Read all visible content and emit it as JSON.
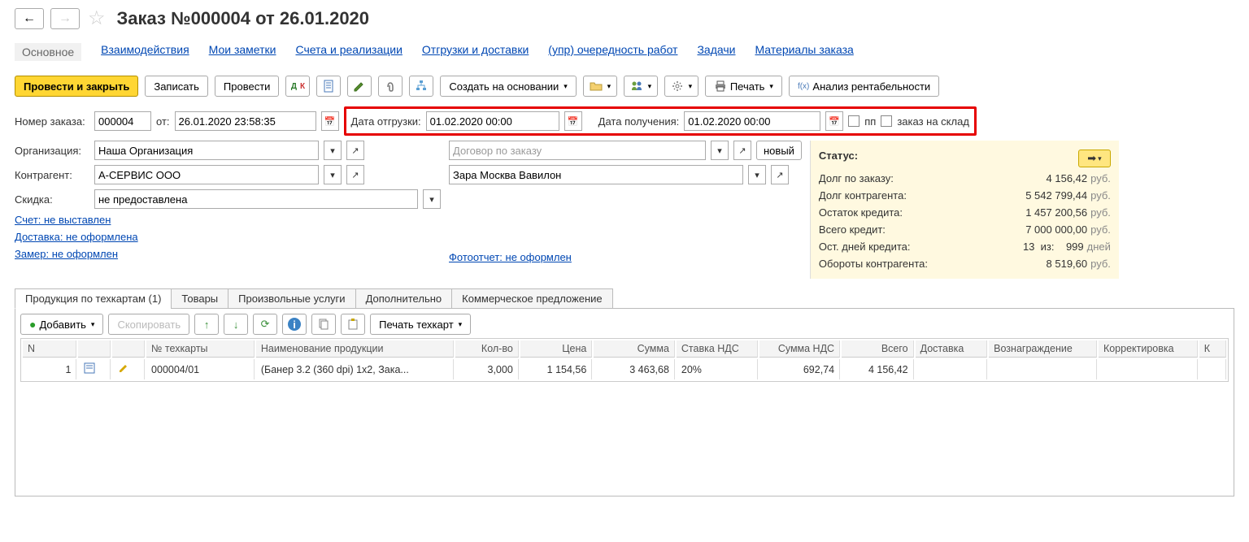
{
  "title": "Заказ №000004 от 26.01.2020",
  "nav_tabs": [
    "Основное",
    "Взаимодействия",
    "Мои заметки",
    "Счета и реализации",
    "Отгрузки и доставки",
    "(упр) очередность работ",
    "Задачи",
    "Материалы заказа"
  ],
  "toolbar": {
    "process_close": "Провести и закрыть",
    "record": "Записать",
    "process": "Провести",
    "create_based": "Создать на основании",
    "print": "Печать",
    "profit": "Анализ рентабельности"
  },
  "form": {
    "order_no_lbl": "Номер заказа:",
    "order_no": "000004",
    "from_lbl": "от:",
    "order_dt": "26.01.2020 23:58:35",
    "ship_lbl": "Дата отгрузки:",
    "ship_dt": "01.02.2020 00:00",
    "recv_lbl": "Дата получения:",
    "recv_dt": "01.02.2020 00:00",
    "pp_lbl": "пп",
    "to_stock_lbl": "заказ на склад",
    "org_lbl": "Организация:",
    "org": "Наша Организация",
    "contract_ph": "Договор по заказу",
    "new_btn": "новый",
    "contr_lbl": "Контрагент:",
    "contr": "А-СЕРВИС ООО",
    "addr": "Зара Москва Вавилон",
    "disc_lbl": "Скидка:",
    "disc": "не предоставлена",
    "invoice_link": "Счет: не выставлен",
    "delivery_link": "Доставка: не оформлена",
    "measure_link": "Замер: не оформлен",
    "photo_link": "Фотоотчет: не оформлен"
  },
  "status": {
    "title": "Статус:",
    "rows": [
      {
        "l": "Долг по заказу:",
        "v": "4 156,42",
        "u": "руб."
      },
      {
        "l": "Долг контрагента:",
        "v": "5 542 799,44",
        "u": "руб."
      },
      {
        "l": "Остаток кредита:",
        "v": "1 457 200,56",
        "u": "руб."
      },
      {
        "l": "Всего кредит:",
        "v": "7 000 000,00",
        "u": "руб."
      }
    ],
    "credit_days_lbl": "Ост. дней кредита:",
    "credit_days": "13",
    "of_lbl": "из:",
    "of_val": "999",
    "days_u": "дней",
    "turnover_lbl": "Обороты контрагента:",
    "turnover": "8 519,60",
    "turnover_u": "руб."
  },
  "subtabs": [
    "Продукция по техкартам (1)",
    "Товары",
    "Произвольные услуги",
    "Дополнительно",
    "Коммерческое предложение"
  ],
  "grid_toolbar": {
    "add": "Добавить",
    "copy": "Скопировать",
    "print_tc": "Печать техкарт"
  },
  "grid": {
    "cols": [
      "N",
      "",
      "",
      "№ техкарты",
      "Наименование продукции",
      "Кол-во",
      "Цена",
      "Сумма",
      "Ставка НДС",
      "Сумма НДС",
      "Всего",
      "Доставка",
      "Вознаграждение",
      "Корректировка",
      "К"
    ],
    "row": {
      "n": "1",
      "tc": "000004/01",
      "name": "(Банер 3.2 (360 dpi)  1x2, Зака...",
      "qty": "3,000",
      "price": "1 154,56",
      "sum": "3 463,68",
      "vat": "20%",
      "vat_sum": "692,74",
      "total": "4 156,42"
    }
  }
}
